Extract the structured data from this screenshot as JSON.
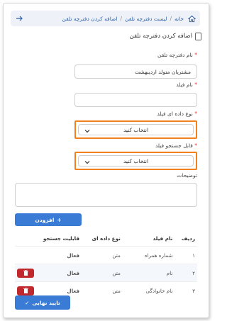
{
  "breadcrumb": {
    "home": "خانه",
    "list": "لیست دفترچه تلفن",
    "current": "اضافه کردن دفترچه تلفن",
    "separator": "/"
  },
  "page": {
    "title": "اضافه کردن دفترچه تلفن"
  },
  "form": {
    "phonebook_name": {
      "label": "نام دفترچه تلفن",
      "value": "مشتریان متولد اردیبهشت",
      "required": true
    },
    "field_name": {
      "label": "نام فیلد",
      "value": "",
      "required": true
    },
    "field_type": {
      "label": "نوع داده ای فیلد",
      "selected": "انتخاب کنید",
      "required": true
    },
    "searchable": {
      "label": "قابل جستجو فیلد",
      "selected": "انتخاب کنید",
      "required": true
    },
    "description": {
      "label": "توضیحات",
      "value": ""
    },
    "required_mark": "*"
  },
  "buttons": {
    "add": "افزودن",
    "add_icon": "+",
    "submit": "تایید نهایی",
    "submit_icon": "✓"
  },
  "table": {
    "headers": [
      "ردیف",
      "نام فیلد",
      "نوع داده ای",
      "قابلیت جستجو"
    ],
    "rows": [
      {
        "index": "۱",
        "name": "شماره همراه",
        "type": "متن",
        "searchable": "فعال",
        "deletable": false
      },
      {
        "index": "۲",
        "name": "نام",
        "type": "متن",
        "searchable": "فعال",
        "deletable": true
      },
      {
        "index": "۳",
        "name": "نام خانوادگی",
        "type": "متن",
        "searchable": "فعال",
        "deletable": true
      }
    ]
  },
  "colors": {
    "primary": "#3a7bd5",
    "highlight": "#f2811d",
    "danger": "#c0282d",
    "success": "#2e9e48",
    "required": "#e53935"
  }
}
